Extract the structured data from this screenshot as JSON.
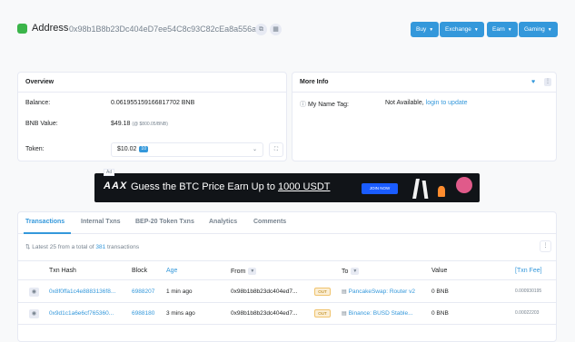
{
  "header": {
    "title": "Address",
    "address": "0x98b1B8b23Dc404eD7ee54C8c93C82cEa8a556ac7",
    "buttons": [
      {
        "label": "Buy",
        "name": "buy"
      },
      {
        "label": "Exchange",
        "name": "exchange"
      },
      {
        "label": "Earn",
        "name": "earn"
      },
      {
        "label": "Gaming",
        "name": "gaming"
      }
    ]
  },
  "overview": {
    "title": "Overview",
    "balance_label": "Balance:",
    "balance_value": "0.061955159166817702 BNB",
    "bnb_value_label": "BNB Value:",
    "bnb_value": "$49.18",
    "bnb_rate": "(@ $800.05/BNB)",
    "token_label": "Token:",
    "token_value": "$10.02",
    "token_count": "10"
  },
  "more_info": {
    "title": "More Info",
    "tag_label": "My Name Tag:",
    "tag_value": "Not Available,",
    "tag_link": "login to update"
  },
  "ad": {
    "label": "Ad",
    "logo": "AAX",
    "text_prefix": "Guess the BTC Price  Earn Up to",
    "text_highlight": "1000 USDT",
    "cta": "JOIN NOW"
  },
  "tabs": [
    {
      "label": "Transactions",
      "active": true
    },
    {
      "label": "Internal Txns",
      "active": false
    },
    {
      "label": "BEP-20 Token Txns",
      "active": false
    },
    {
      "label": "Analytics",
      "active": false
    },
    {
      "label": "Comments",
      "active": false
    }
  ],
  "summary": {
    "prefix": "Latest 25 from a total of",
    "count": "381",
    "suffix": "transactions"
  },
  "table": {
    "columns": [
      "Txn Hash",
      "Block",
      "Age",
      "From",
      "To",
      "Value",
      "[Txn Fee]"
    ],
    "rows": [
      {
        "hash": "0x8f0ffa1c4e8883136f8...",
        "block": "6988207",
        "age": "1 min ago",
        "from": "0x98b1b8b23dc404ed7...",
        "direction": "OUT",
        "to": "PancakeSwap: Router v2",
        "value": "0 BNB",
        "fee": "0.000930195"
      },
      {
        "hash": "0x9d1c1a6e6cf765360...",
        "block": "6988180",
        "age": "3 mins ago",
        "from": "0x98b1b8b23dc404ed7...",
        "direction": "OUT",
        "to": "Binance: BUSD Stable...",
        "value": "0 BNB",
        "fee": "0.00022203"
      }
    ]
  }
}
